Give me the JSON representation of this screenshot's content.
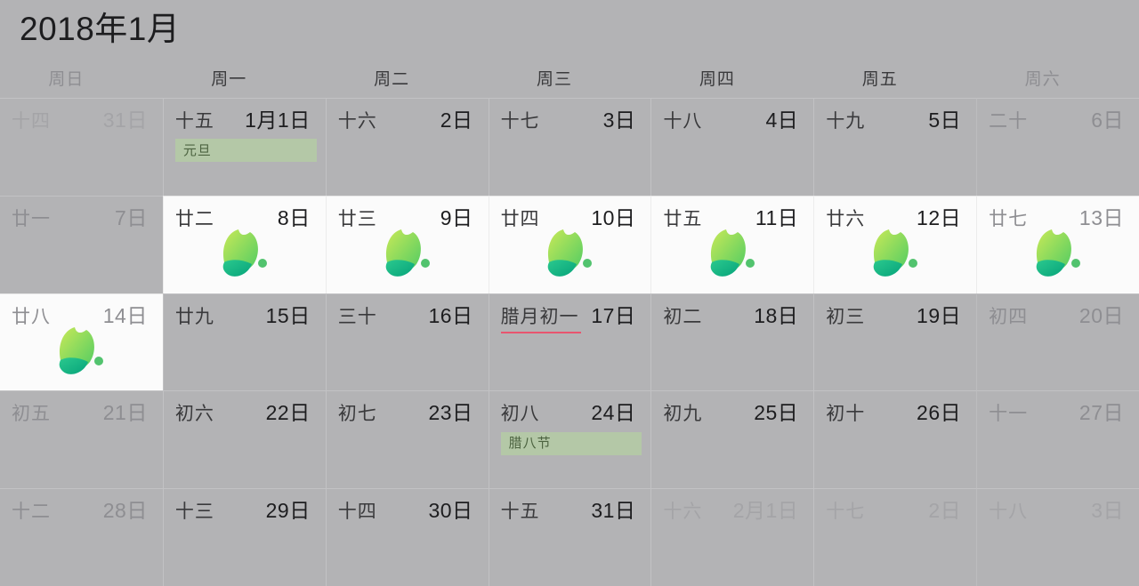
{
  "header": {
    "title": "2018年1月"
  },
  "weekdays": [
    {
      "label": "周日",
      "weekend": true
    },
    {
      "label": "周一",
      "weekend": false
    },
    {
      "label": "周二",
      "weekend": false
    },
    {
      "label": "周三",
      "weekend": false
    },
    {
      "label": "周四",
      "weekend": false
    },
    {
      "label": "周五",
      "weekend": false
    },
    {
      "label": "周六",
      "weekend": true
    }
  ],
  "icons": {
    "leaf": "leaf-icon",
    "leaf_colors": {
      "upper_start": "#c6e84f",
      "upper_end": "#46c95b",
      "lower_start": "#2bc98e",
      "lower_end": "#06a37a",
      "dot": "#3fbd5e"
    }
  },
  "colors": {
    "background": "#b3b3b5",
    "cell_highlight": "#fbfbfb",
    "event_bar": "#b4c8a7",
    "event_text": "#4c6340",
    "lunar_new_month_underline": "#e8556f",
    "text_primary": "#1d1d1f",
    "text_dim": "#8e8e92"
  },
  "weeks": [
    [
      {
        "lunar": "十四",
        "solar": "31日",
        "outside": true,
        "weekend": true,
        "white": false,
        "icon": false,
        "event": null,
        "new_lunar_month": false
      },
      {
        "lunar": "十五",
        "solar": "1月1日",
        "outside": false,
        "weekend": false,
        "white": false,
        "icon": false,
        "event": "元旦",
        "new_lunar_month": false
      },
      {
        "lunar": "十六",
        "solar": "2日",
        "outside": false,
        "weekend": false,
        "white": false,
        "icon": false,
        "event": null,
        "new_lunar_month": false
      },
      {
        "lunar": "十七",
        "solar": "3日",
        "outside": false,
        "weekend": false,
        "white": false,
        "icon": false,
        "event": null,
        "new_lunar_month": false
      },
      {
        "lunar": "十八",
        "solar": "4日",
        "outside": false,
        "weekend": false,
        "white": false,
        "icon": false,
        "event": null,
        "new_lunar_month": false
      },
      {
        "lunar": "十九",
        "solar": "5日",
        "outside": false,
        "weekend": false,
        "white": false,
        "icon": false,
        "event": null,
        "new_lunar_month": false
      },
      {
        "lunar": "二十",
        "solar": "6日",
        "outside": false,
        "weekend": true,
        "white": false,
        "icon": false,
        "event": null,
        "new_lunar_month": false
      }
    ],
    [
      {
        "lunar": "廿一",
        "solar": "7日",
        "outside": false,
        "weekend": true,
        "white": false,
        "icon": false,
        "event": null,
        "new_lunar_month": false
      },
      {
        "lunar": "廿二",
        "solar": "8日",
        "outside": false,
        "weekend": false,
        "white": true,
        "icon": true,
        "event": null,
        "new_lunar_month": false
      },
      {
        "lunar": "廿三",
        "solar": "9日",
        "outside": false,
        "weekend": false,
        "white": true,
        "icon": true,
        "event": null,
        "new_lunar_month": false
      },
      {
        "lunar": "廿四",
        "solar": "10日",
        "outside": false,
        "weekend": false,
        "white": true,
        "icon": true,
        "event": null,
        "new_lunar_month": false
      },
      {
        "lunar": "廿五",
        "solar": "11日",
        "outside": false,
        "weekend": false,
        "white": true,
        "icon": true,
        "event": null,
        "new_lunar_month": false
      },
      {
        "lunar": "廿六",
        "solar": "12日",
        "outside": false,
        "weekend": false,
        "white": true,
        "icon": true,
        "event": null,
        "new_lunar_month": false
      },
      {
        "lunar": "廿七",
        "solar": "13日",
        "outside": false,
        "weekend": true,
        "white": true,
        "icon": true,
        "event": null,
        "new_lunar_month": false
      }
    ],
    [
      {
        "lunar": "廿八",
        "solar": "14日",
        "outside": false,
        "weekend": true,
        "white": true,
        "icon": true,
        "event": null,
        "new_lunar_month": false
      },
      {
        "lunar": "廿九",
        "solar": "15日",
        "outside": false,
        "weekend": false,
        "white": false,
        "icon": false,
        "event": null,
        "new_lunar_month": false
      },
      {
        "lunar": "三十",
        "solar": "16日",
        "outside": false,
        "weekend": false,
        "white": false,
        "icon": false,
        "event": null,
        "new_lunar_month": false
      },
      {
        "lunar": "腊月初一",
        "solar": "17日",
        "outside": false,
        "weekend": false,
        "white": false,
        "icon": false,
        "event": null,
        "new_lunar_month": true
      },
      {
        "lunar": "初二",
        "solar": "18日",
        "outside": false,
        "weekend": false,
        "white": false,
        "icon": false,
        "event": null,
        "new_lunar_month": false
      },
      {
        "lunar": "初三",
        "solar": "19日",
        "outside": false,
        "weekend": false,
        "white": false,
        "icon": false,
        "event": null,
        "new_lunar_month": false
      },
      {
        "lunar": "初四",
        "solar": "20日",
        "outside": false,
        "weekend": true,
        "white": false,
        "icon": false,
        "event": null,
        "new_lunar_month": false
      }
    ],
    [
      {
        "lunar": "初五",
        "solar": "21日",
        "outside": false,
        "weekend": true,
        "white": false,
        "icon": false,
        "event": null,
        "new_lunar_month": false
      },
      {
        "lunar": "初六",
        "solar": "22日",
        "outside": false,
        "weekend": false,
        "white": false,
        "icon": false,
        "event": null,
        "new_lunar_month": false
      },
      {
        "lunar": "初七",
        "solar": "23日",
        "outside": false,
        "weekend": false,
        "white": false,
        "icon": false,
        "event": null,
        "new_lunar_month": false
      },
      {
        "lunar": "初八",
        "solar": "24日",
        "outside": false,
        "weekend": false,
        "white": false,
        "icon": false,
        "event": "腊八节",
        "new_lunar_month": false
      },
      {
        "lunar": "初九",
        "solar": "25日",
        "outside": false,
        "weekend": false,
        "white": false,
        "icon": false,
        "event": null,
        "new_lunar_month": false
      },
      {
        "lunar": "初十",
        "solar": "26日",
        "outside": false,
        "weekend": false,
        "white": false,
        "icon": false,
        "event": null,
        "new_lunar_month": false
      },
      {
        "lunar": "十一",
        "solar": "27日",
        "outside": false,
        "weekend": true,
        "white": false,
        "icon": false,
        "event": null,
        "new_lunar_month": false
      }
    ],
    [
      {
        "lunar": "十二",
        "solar": "28日",
        "outside": false,
        "weekend": true,
        "white": false,
        "icon": false,
        "event": null,
        "new_lunar_month": false
      },
      {
        "lunar": "十三",
        "solar": "29日",
        "outside": false,
        "weekend": false,
        "white": false,
        "icon": false,
        "event": null,
        "new_lunar_month": false
      },
      {
        "lunar": "十四",
        "solar": "30日",
        "outside": false,
        "weekend": false,
        "white": false,
        "icon": false,
        "event": null,
        "new_lunar_month": false
      },
      {
        "lunar": "十五",
        "solar": "31日",
        "outside": false,
        "weekend": false,
        "white": false,
        "icon": false,
        "event": null,
        "new_lunar_month": false
      },
      {
        "lunar": "十六",
        "solar": "2月1日",
        "outside": true,
        "weekend": false,
        "white": false,
        "icon": false,
        "event": null,
        "new_lunar_month": false
      },
      {
        "lunar": "十七",
        "solar": "2日",
        "outside": true,
        "weekend": false,
        "white": false,
        "icon": false,
        "event": null,
        "new_lunar_month": false
      },
      {
        "lunar": "十八",
        "solar": "3日",
        "outside": true,
        "weekend": true,
        "white": false,
        "icon": false,
        "event": null,
        "new_lunar_month": false
      }
    ]
  ]
}
